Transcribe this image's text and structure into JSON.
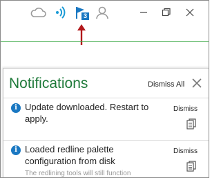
{
  "toolbar": {
    "icons": [
      "cloud-icon",
      "signal-icon",
      "flag-icon",
      "user-icon",
      "minimize-icon",
      "restore-icon",
      "close-icon"
    ],
    "notification_count": "3"
  },
  "panel": {
    "title": "Notifications",
    "dismiss_all_label": "Dismiss All"
  },
  "notifications": [
    {
      "message": "Update downloaded. Restart to apply.",
      "subtext": "",
      "dismiss_label": "Dismiss"
    },
    {
      "message": "Loaded redline palette configuration from disk",
      "subtext": "The redlining tools will still function",
      "dismiss_label": "Dismiss"
    }
  ],
  "colors": {
    "accent_green": "#1f7a3a",
    "info_blue": "#1a78c2",
    "callout_red": "#b2181b"
  }
}
